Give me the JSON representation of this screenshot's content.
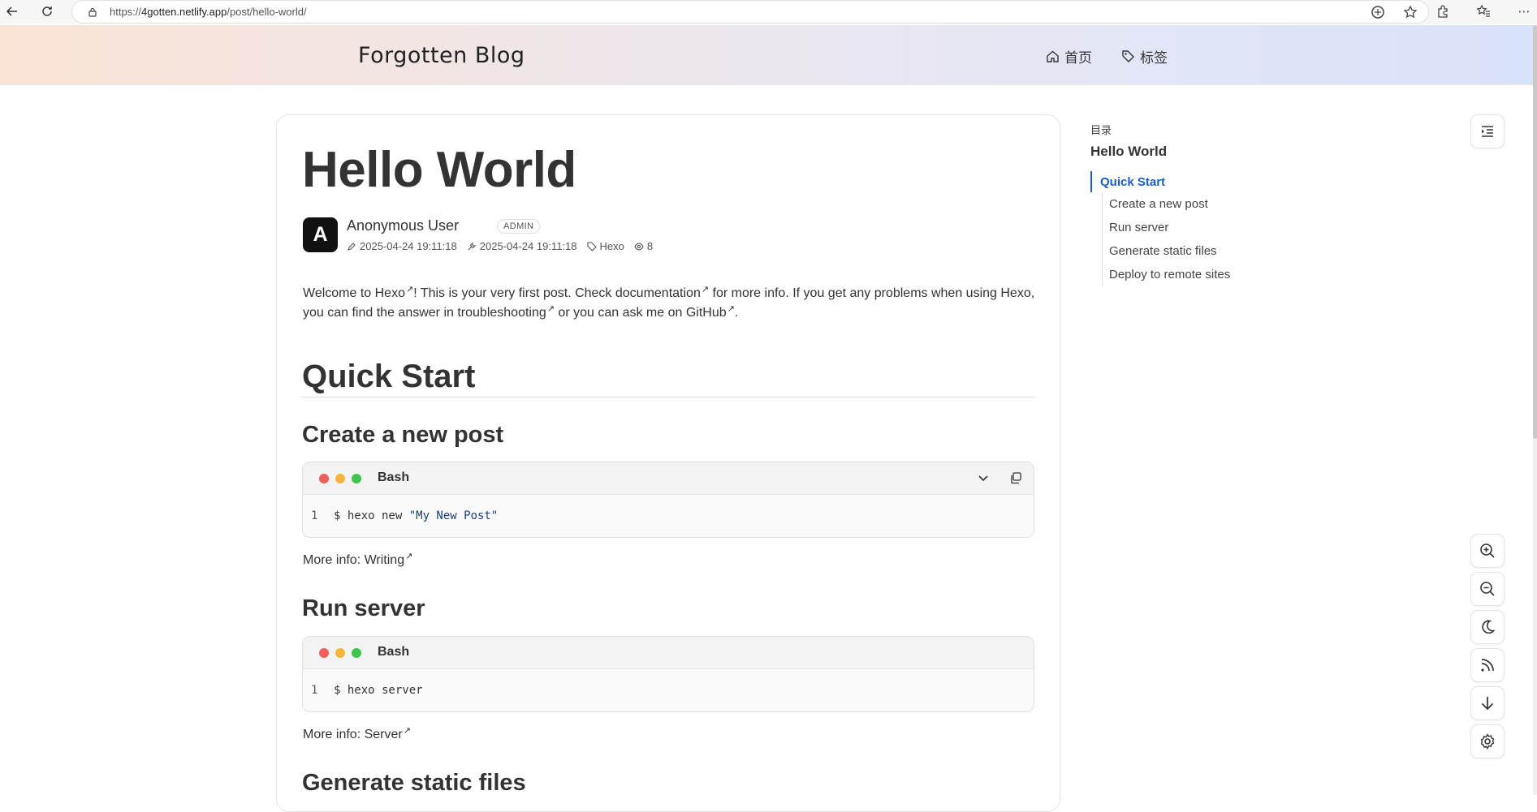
{
  "browser": {
    "url_scheme": "https://",
    "url_host": "4gotten.netlify.app",
    "url_path": "/post/hello-world/"
  },
  "site": {
    "brand": "Forgotten Blog",
    "nav": [
      {
        "label": "首页",
        "icon": "home-icon"
      },
      {
        "label": "标签",
        "icon": "tag-icon"
      }
    ]
  },
  "post": {
    "title": "Hello World",
    "author": {
      "avatar_letter": "A",
      "name": "Anonymous User",
      "badge": "ADMIN"
    },
    "meta": {
      "created": "2025-04-24 19:11:18",
      "updated": "2025-04-24 19:11:18",
      "tag": "Hexo",
      "views": "8"
    },
    "intro": {
      "t1": "Welcome to ",
      "l1": "Hexo",
      "t2": "! This is your very first post. Check ",
      "l2": "documentation",
      "t3": " for more info. If you get any problems when using Hexo, you can find the answer in ",
      "l3": "troubleshooting",
      "t4": " or you can ask me on ",
      "l4": "GitHub",
      "t5": "."
    },
    "ext_glyph": "↗",
    "sections": {
      "quick_start": "Quick Start",
      "create_post": "Create a new post",
      "run_server": "Run server",
      "generate": "Generate static files"
    },
    "code1": {
      "lang": "Bash",
      "line_no": "1",
      "cmd": "$ hexo new ",
      "str": "\"My New Post\""
    },
    "more1": {
      "prefix": "More info: ",
      "link": "Writing"
    },
    "code2": {
      "lang": "Bash",
      "line_no": "1",
      "cmd": "$ hexo server"
    },
    "more2": {
      "prefix": "More info: ",
      "link": "Server"
    }
  },
  "toc": {
    "label": "目录",
    "title": "Hello World",
    "active": "Quick Start",
    "items": [
      "Create a new post",
      "Run server",
      "Generate static files",
      "Deploy to remote sites"
    ]
  },
  "colors": {
    "accent": "#1d5ec5",
    "dot_red": "#ee5f57",
    "dot_yellow": "#f5b53a",
    "dot_green": "#3fc54c"
  },
  "floating_tools": [
    "zoom-in-icon",
    "zoom-out-icon",
    "moon-icon",
    "rss-icon",
    "arrow-down-icon",
    "gear-icon"
  ]
}
